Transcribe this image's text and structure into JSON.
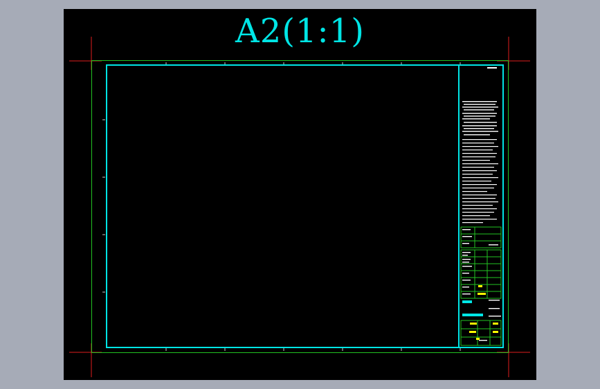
{
  "sheet": {
    "title": "A2(1:1)"
  },
  "colors": {
    "background": "#000000",
    "app_border": "#a6abb7",
    "title": "#00e5e5",
    "frame_inner": "#00e5e5",
    "frame_outer": "#22c322",
    "trim_marks": "#e01e1e",
    "note_text": "#ffffff",
    "highlight_text": "#ffff00"
  },
  "icons": [
    "trim-mark-icon"
  ]
}
